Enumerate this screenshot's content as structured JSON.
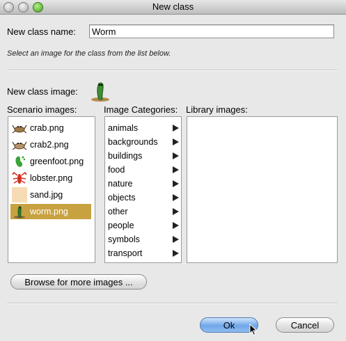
{
  "window": {
    "title": "New class"
  },
  "form": {
    "class_name_label": "New class name:",
    "class_name_value": "Worm",
    "hint": "Select an image for the class from the list below.",
    "class_image_label": "New class image:"
  },
  "scenario": {
    "header": "Scenario images:",
    "items": [
      {
        "label": "crab.png",
        "icon": "crab-icon",
        "selected": false
      },
      {
        "label": "crab2.png",
        "icon": "crab-icon",
        "selected": false
      },
      {
        "label": "greenfoot.png",
        "icon": "greenfoot-icon",
        "selected": false
      },
      {
        "label": "lobster.png",
        "icon": "lobster-icon",
        "selected": false
      },
      {
        "label": "sand.jpg",
        "icon": "sand-icon",
        "selected": false
      },
      {
        "label": "worm.png",
        "icon": "worm-icon",
        "selected": true
      }
    ]
  },
  "categories": {
    "header": "Image Categories:",
    "items": [
      "animals",
      "backgrounds",
      "buildings",
      "food",
      "nature",
      "objects",
      "other",
      "people",
      "symbols",
      "transport"
    ]
  },
  "library": {
    "header": "Library images:",
    "items": []
  },
  "buttons": {
    "browse": "Browse for more images ...",
    "ok": "Ok",
    "cancel": "Cancel"
  },
  "colors": {
    "selection": "#c8a240",
    "default_button": "#6fa7e8"
  }
}
